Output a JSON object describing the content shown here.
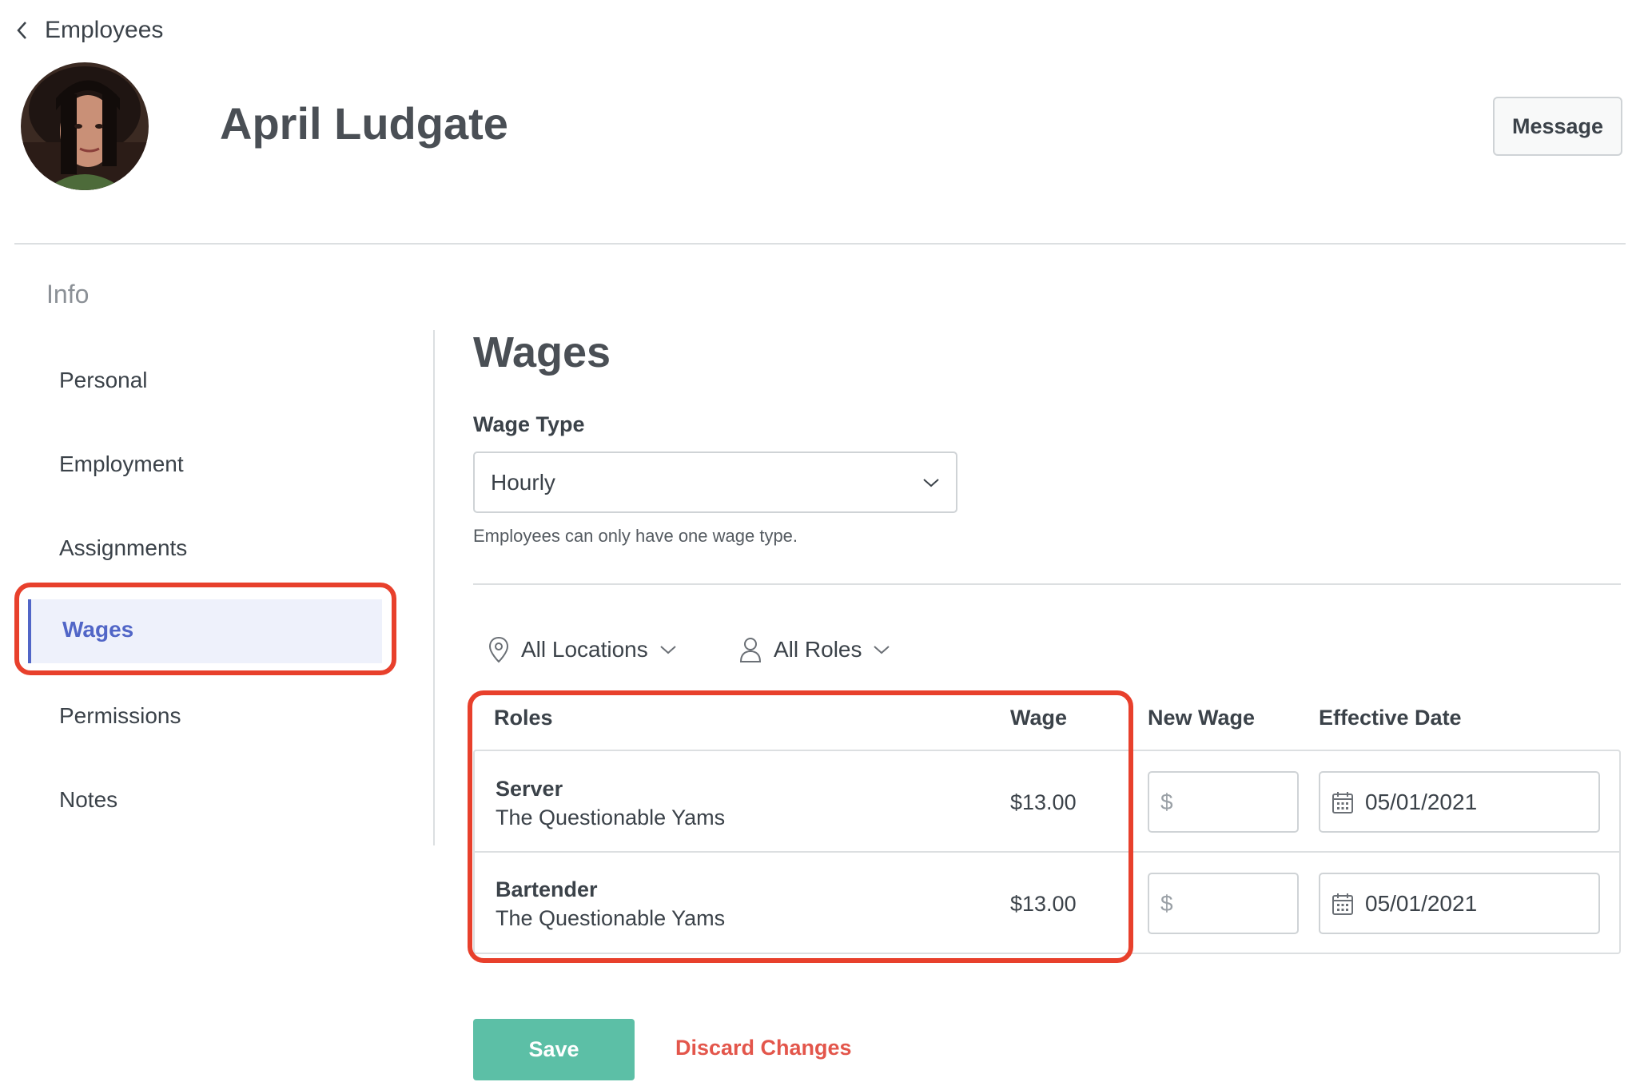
{
  "nav": {
    "back_label": "Employees"
  },
  "employee": {
    "name": "April Ludgate"
  },
  "header": {
    "message_label": "Message"
  },
  "sidebar": {
    "title": "Info",
    "items": [
      {
        "label": "Personal"
      },
      {
        "label": "Employment"
      },
      {
        "label": "Assignments"
      },
      {
        "label": "Wages"
      },
      {
        "label": "Permissions"
      },
      {
        "label": "Notes"
      }
    ],
    "active": "Wages"
  },
  "main": {
    "title": "Wages",
    "wage_type_label": "Wage Type",
    "wage_type_value": "Hourly",
    "wage_type_helper": "Employees can only have one wage type.",
    "filters": {
      "locations": "All Locations",
      "roles": "All Roles"
    },
    "table": {
      "headers": {
        "roles": "Roles",
        "wage": "Wage",
        "new_wage": "New Wage",
        "effective_date": "Effective Date"
      },
      "rows": [
        {
          "role": "Server",
          "location": "The Questionable Yams",
          "wage": "$13.00",
          "new_wage_prefix": "$",
          "effective_date": "05/01/2021"
        },
        {
          "role": "Bartender",
          "location": "The Questionable Yams",
          "wage": "$13.00",
          "new_wage_prefix": "$",
          "effective_date": "05/01/2021"
        }
      ]
    },
    "actions": {
      "save": "Save",
      "discard": "Discard Changes"
    }
  },
  "colors": {
    "accent": "#5166c7",
    "save": "#5cbfa6",
    "discard": "#e3564b",
    "highlight": "#e8402c"
  }
}
